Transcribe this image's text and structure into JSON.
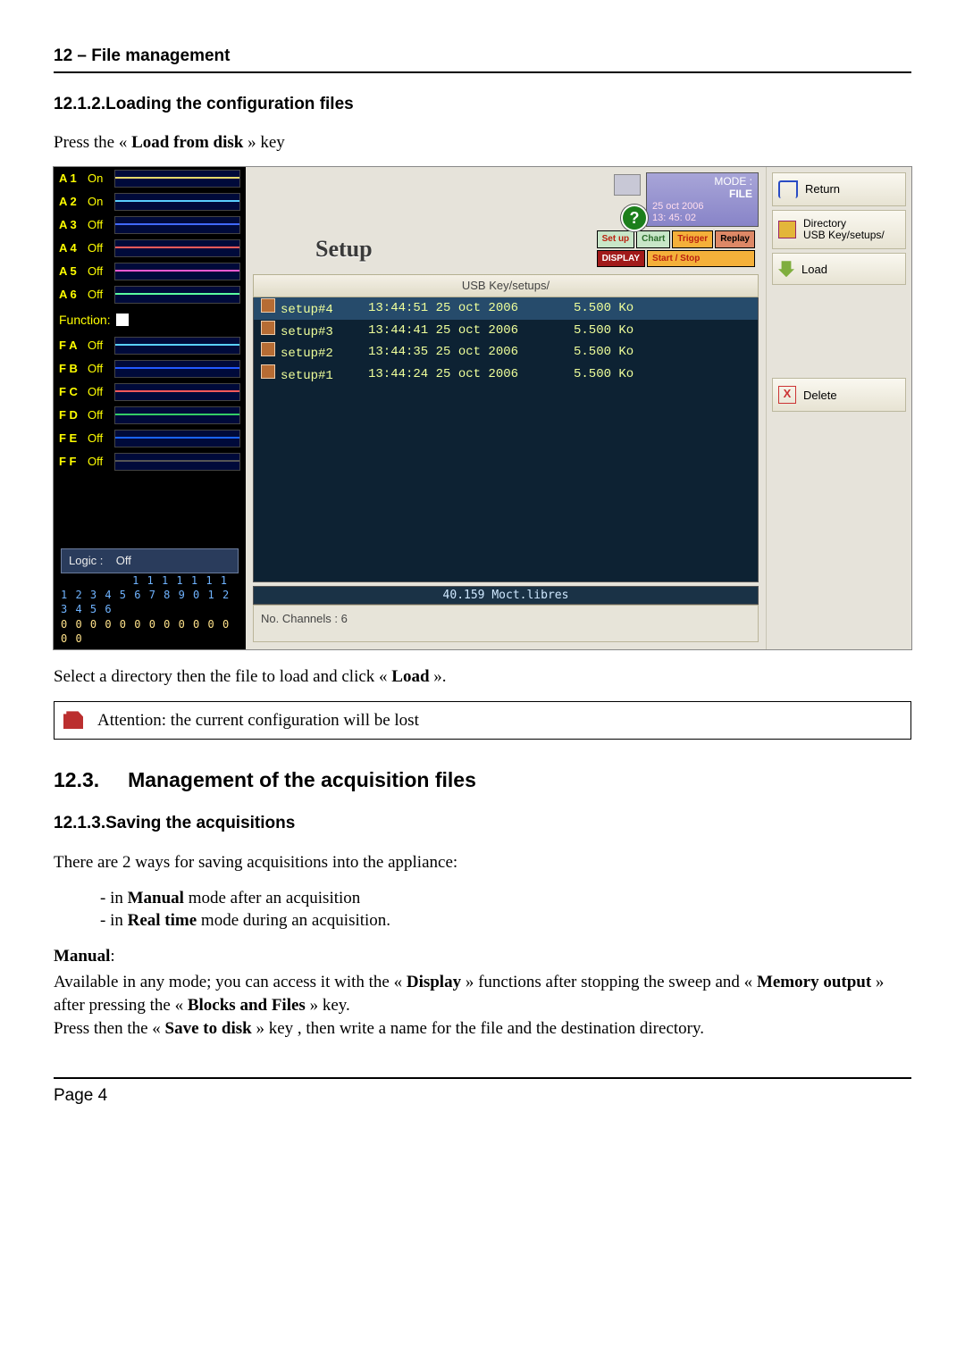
{
  "page": {
    "chapter": "12 – File management",
    "h_loading": "12.1.2.Loading the configuration files",
    "press_load_from_disk_pre": "Press the « ",
    "press_load_from_disk_bold": "Load from disk",
    "press_load_from_disk_post": " » key",
    "after_shot": "Select a directory then the file to load and click « ",
    "after_shot_bold": "Load",
    "after_shot_end": " ».",
    "note": "Attention: the current configuration will be lost",
    "h_mgmt_num": "12.3.",
    "h_mgmt_txt": "Management of the acquisition files",
    "h_saving": "12.1.3.Saving the acquisitions",
    "twoways": "There are 2 ways for saving acquisitions into the appliance:",
    "li1_pre": "in ",
    "li1_b": "Manual",
    "li1_post": " mode after an acquisition",
    "li2_pre": "in ",
    "li2_b": "Real time",
    "li2_post": " mode during an acquisition.",
    "manual_h": "Manual",
    "manual1a": "Available in any mode; you can access it with the « ",
    "manual1b": "Display",
    "manual1c": " » functions after stopping the sweep and « ",
    "manual1d": "Memory output",
    "manual1e": " » after pressing the « ",
    "manual1f": "Blocks and Files",
    "manual1g": " » key.",
    "manual2a": "Press then the « ",
    "manual2b": "Save to disk",
    "manual2c": " » key , then write a name for the file and the destination directory.",
    "footer": "Page 4"
  },
  "app": {
    "channels": [
      {
        "name": "A 1",
        "state": "On"
      },
      {
        "name": "A 2",
        "state": "On"
      },
      {
        "name": "A 3",
        "state": "Off"
      },
      {
        "name": "A 4",
        "state": "Off"
      },
      {
        "name": "A 5",
        "state": "Off"
      },
      {
        "name": "A 6",
        "state": "Off"
      }
    ],
    "function_label": "Function:",
    "fchannels": [
      {
        "name": "F A",
        "state": "Off"
      },
      {
        "name": "F B",
        "state": "Off"
      },
      {
        "name": "F C",
        "state": "Off"
      },
      {
        "name": "F D",
        "state": "Off"
      },
      {
        "name": "F E",
        "state": "Off"
      },
      {
        "name": "F F",
        "state": "Off"
      }
    ],
    "logic_label": "Logic :",
    "logic_state": "Off",
    "logic_bits_top": "1 1 1 1 1 1 1",
    "logic_bits_mid": "1 2 3 4 5 6 7 8 9 0 1 2 3 4 5 6",
    "logic_bits_bot": "0 0   0 0 0 0 0 0 0 0 0 0 0 0",
    "mode_line1": "MODE :",
    "mode_line2": "FILE",
    "mode_date": "25 oct 2006",
    "mode_time": "13: 45: 02",
    "tabs": {
      "setup": "Set up",
      "chart": "Chart",
      "trigger": "Trigger",
      "replay": "Replay",
      "display": "DISPLAY",
      "startstop": "Start / Stop"
    },
    "setup_title": "Setup",
    "list_header": "USB Key/setups/",
    "files": [
      {
        "name": "setup#4",
        "ts": "13:44:51 25 oct 2006",
        "size": "5.500 Ko"
      },
      {
        "name": "setup#3",
        "ts": "13:44:41 25 oct 2006",
        "size": "5.500 Ko"
      },
      {
        "name": "setup#2",
        "ts": "13:44:35 25 oct 2006",
        "size": "5.500 Ko"
      },
      {
        "name": "setup#1",
        "ts": "13:44:24 25 oct 2006",
        "size": "5.500 Ko"
      }
    ],
    "free": "40.159 Moct.libres",
    "no_channels": "No. Channels : 6",
    "buttons": {
      "return": "Return",
      "directory_l1": "Directory",
      "directory_l2": "USB Key/setups/",
      "load": "Load",
      "delete": "Delete"
    }
  }
}
